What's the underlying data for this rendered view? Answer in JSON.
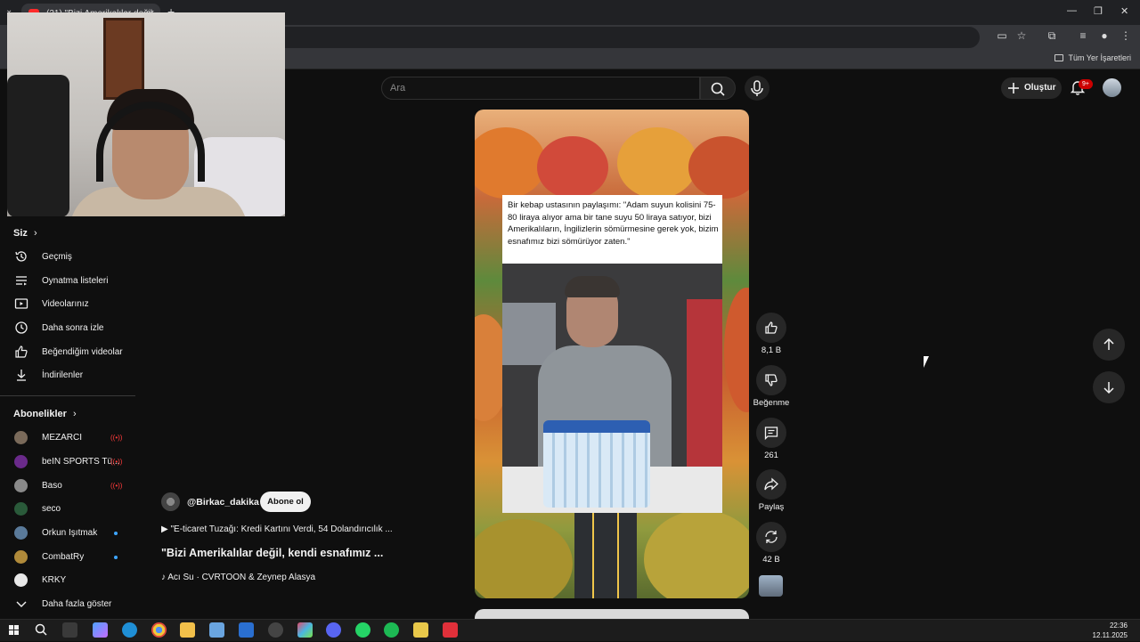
{
  "browser": {
    "tab_title": "(21) \"Bizi Amerikalılar değil...",
    "bookmarks_all": "Tüm Yer İşaretleri"
  },
  "sidebar": {
    "you_title": "Siz",
    "you_items": [
      {
        "label": "Geçmiş",
        "icon": "history-icon"
      },
      {
        "label": "Oynatma listeleri",
        "icon": "playlist-icon"
      },
      {
        "label": "Videolarınız",
        "icon": "your-videos-icon"
      },
      {
        "label": "Daha sonra izle",
        "icon": "watch-later-icon"
      },
      {
        "label": "Beğendiğim videolar",
        "icon": "liked-icon"
      },
      {
        "label": "İndirilenler",
        "icon": "download-icon"
      }
    ],
    "subs_title": "Abonelikler",
    "subscriptions": [
      {
        "label": "MEZARCI",
        "status": "live"
      },
      {
        "label": "beIN SPORTS Tü...",
        "status": "live"
      },
      {
        "label": "Baso",
        "status": "live"
      },
      {
        "label": "seco",
        "status": ""
      },
      {
        "label": "Orkun Işıtmak",
        "status": "new"
      },
      {
        "label": "CombatRy",
        "status": "new"
      },
      {
        "label": "KRKY",
        "status": ""
      }
    ],
    "show_more": "Daha fazla göster"
  },
  "header": {
    "search_placeholder": "Ara",
    "create_label": "Oluştur",
    "notifications_badge": "9+"
  },
  "short": {
    "caption": "Bir kebap ustasının paylaşımı: \"Adam suyun kolisini 75-80 liraya alıyor ama bir tane suyu 50 liraya satıyor, bizi Amerikalıların, İngilizlerin sömürmesine gerek yok, bizim esnafımız bizi sömürüyor zaten.\"",
    "channel": "@Birkac_dakika",
    "subscribe": "Abone ol",
    "playlist": "\"E-ticaret Tuzağı: Kredi Kartını Verdi, 54 Dolandırıcılık ...",
    "title": "\"Bizi Amerikalılar değil, kendi esnafımız ...",
    "sound": "Acı Su · CVRTOON & Zeynep Alasya"
  },
  "actions": {
    "likes": "8,1 B",
    "dislike": "Beğenme",
    "comments": "261",
    "share": "Paylaş",
    "remix": "42 B"
  },
  "taskbar": {
    "time": "22:36",
    "date": "12.11.2025"
  },
  "colors": {
    "background": "#0f0f0f",
    "live": "#ff3b3b",
    "badge": "#cc0000",
    "new_dot": "#3ea6ff"
  }
}
